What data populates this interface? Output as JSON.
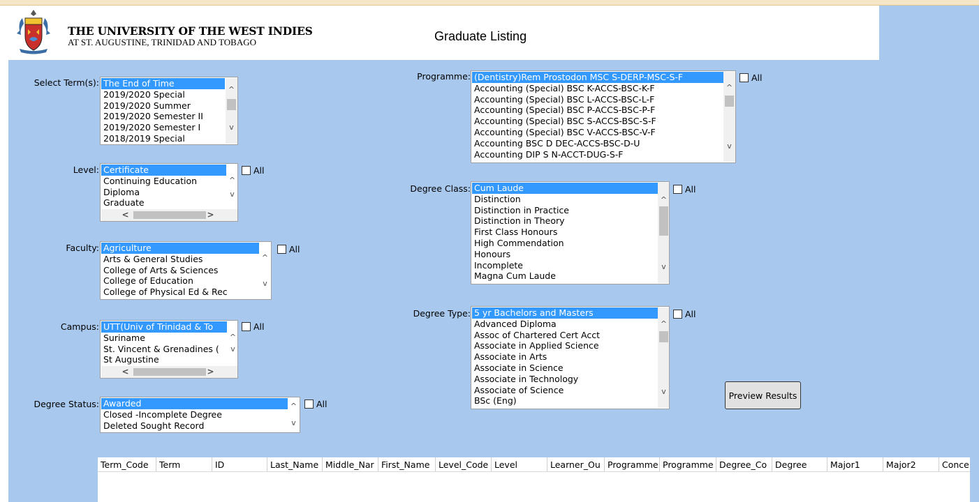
{
  "header": {
    "university_name": "THE UNIVERSITY OF THE WEST INDIES",
    "university_location": "AT ST. AUGUSTINE, TRINIDAD AND TOBAGO",
    "page_title": "Graduate Listing",
    "crest_icon": "university-crest-icon"
  },
  "all_label": "All",
  "filters": {
    "terms": {
      "label": "Select Term(s):",
      "options": [
        "The End of Time",
        "2019/2020 Special",
        "2019/2020 Summer",
        "2019/2020 Semester II",
        "2019/2020 Semester I",
        "2018/2019 Special"
      ],
      "selected": "The End of Time"
    },
    "level": {
      "label": "Level:",
      "options": [
        "Certificate",
        "Continuing Education",
        "Diploma",
        "Graduate"
      ],
      "selected": "Certificate"
    },
    "faculty": {
      "label": "Faculty:",
      "options": [
        "Agriculture",
        "Arts & General Studies",
        "College of Arts & Sciences",
        "College of Education",
        "College of Physical Ed & Rec"
      ],
      "selected": "Agriculture"
    },
    "campus": {
      "label": "Campus:",
      "options": [
        "UTT(Univ of Trinidad & To",
        "Suriname",
        "St. Vincent & Grenadines (",
        "St Augustine"
      ],
      "selected": "UTT(Univ of Trinidad & To"
    },
    "degree_status": {
      "label": "Degree Status:",
      "options": [
        "Awarded",
        "Closed -Incomplete Degree",
        "Deleted Sought Record"
      ],
      "selected": "Awarded"
    },
    "programme": {
      "label": "Programme:",
      "options": [
        "(Dentistry)Rem Prostodon MSC S-DERP-MSC-S-F",
        "Accounting (Special) BSC K-ACCS-BSC-K-F",
        "Accounting (Special) BSC L-ACCS-BSC-L-F",
        "Accounting (Special) BSC P-ACCS-BSC-P-F",
        "Accounting (Special) BSC S-ACCS-BSC-S-F",
        "Accounting (Special) BSC V-ACCS-BSC-V-F",
        "Accounting BSC D DEC-ACCS-BSC-D-U",
        "Accounting DIP S N-ACCT-DUG-S-F"
      ],
      "selected": "(Dentistry)Rem Prostodon MSC S-DERP-MSC-S-F"
    },
    "degree_class": {
      "label": "Degree Class:",
      "options": [
        "Cum Laude",
        "Distinction",
        "Distinction in Practice",
        "Distinction in Theory",
        "First Class Honours",
        "High Commendation",
        "Honours",
        "Incomplete",
        "Magna Cum Laude"
      ],
      "selected": "Cum Laude"
    },
    "degree_type": {
      "label": "Degree Type:",
      "options": [
        "5 yr Bachelors and Masters",
        "Advanced Diploma",
        "Assoc of Chartered Cert Acct",
        "Associate in Applied Science",
        "Associate in Arts",
        "Associate in Science",
        "Associate in Technology",
        "Associate of Science",
        "BSc (Eng)"
      ],
      "selected": "5 yr Bachelors and Masters"
    }
  },
  "actions": {
    "preview_label": "Preview Results"
  },
  "results_table": {
    "columns": [
      "Term_Code",
      "Term",
      "ID",
      "Last_Name",
      "Middle_Nar",
      "First_Name",
      "Level_Code",
      "Level",
      "Learner_Ou",
      "Programme",
      "Programme",
      "Degree_Co",
      "Degree",
      "Major1",
      "Major2",
      "Conce"
    ]
  },
  "colors": {
    "page_background": "#a8c8ee",
    "selection": "#3399ff"
  }
}
